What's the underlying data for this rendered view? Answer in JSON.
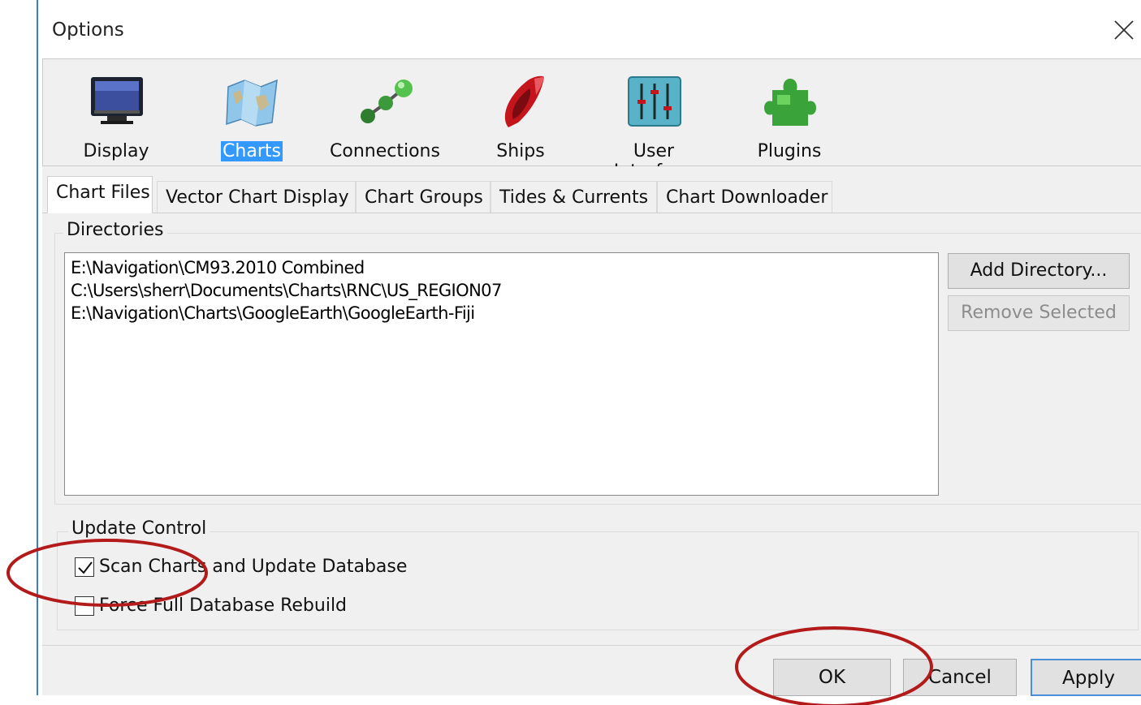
{
  "window": {
    "title": "Options"
  },
  "toolbar": {
    "items": [
      {
        "label": "Display"
      },
      {
        "label": "Charts"
      },
      {
        "label": "Connections"
      },
      {
        "label": "Ships"
      },
      {
        "label": "User Interface"
      },
      {
        "label": "Plugins"
      }
    ]
  },
  "tabs": [
    {
      "label": "Chart Files"
    },
    {
      "label": "Vector Chart Display"
    },
    {
      "label": "Chart Groups"
    },
    {
      "label": "Tides & Currents"
    },
    {
      "label": "Chart Downloader"
    }
  ],
  "directories": {
    "label": "Directories",
    "items": [
      "E:\\Navigation\\CM93.2010 Combined",
      "C:\\Users\\sherr\\Documents\\Charts\\RNC\\US_REGION07",
      "E:\\Navigation\\Charts\\GoogleEarth\\GoogleEarth-Fiji"
    ],
    "add_button": "Add Directory...",
    "remove_button": "Remove Selected"
  },
  "update_control": {
    "label": "Update Control",
    "scan_label": "Scan Charts and Update Database",
    "scan_checked": true,
    "rebuild_label": "Force Full Database Rebuild",
    "rebuild_checked": false
  },
  "footer": {
    "ok": "OK",
    "cancel": "Cancel",
    "apply": "Apply"
  },
  "colors": {
    "selection": "#3399ff",
    "annotation": "#b31b1b",
    "window_border": "#3d7cc9"
  }
}
